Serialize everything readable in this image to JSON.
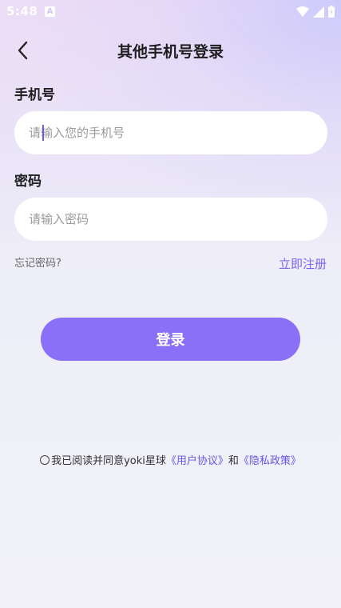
{
  "status_bar": {
    "time": "5:48",
    "notification_icon": "A"
  },
  "header": {
    "title": "其他手机号登录",
    "back_icon": "chevron-left"
  },
  "phone": {
    "label": "手机号",
    "placeholder": "请输入您的手机号",
    "value": ""
  },
  "password": {
    "label": "密码",
    "placeholder": "请输入密码",
    "value": ""
  },
  "links": {
    "forgot": "忘记密码?",
    "register": "立即注册"
  },
  "login_button": "登录",
  "agreement": {
    "text": "我已阅读并同意yoki星球",
    "user_agreement": "《用户协议》",
    "and": "和",
    "privacy_policy": "《隐私政策》",
    "checked": false
  },
  "colors": {
    "accent": "#8a6ff7",
    "link": "#6a55e6",
    "background": "#f1f1f7"
  }
}
